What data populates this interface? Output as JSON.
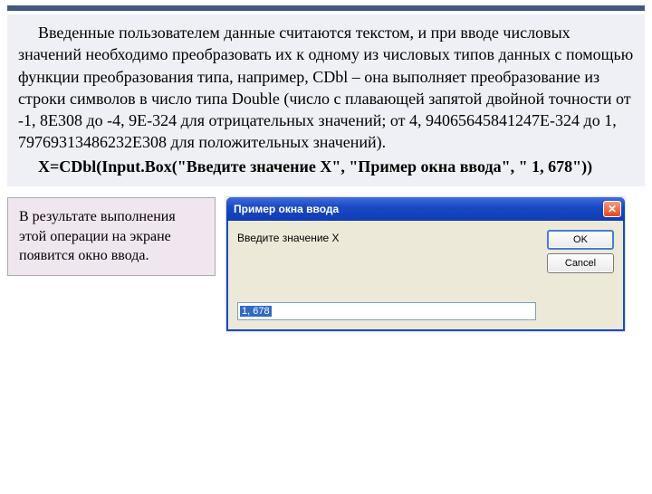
{
  "paragraph": {
    "text": "Введенные  пользователем данные считаются текстом, и при вводе числовых значений необходимо преобразовать их к одному из числовых типов данных с помощью функции преобразования типа, например, CDbl – она выполняет преобразование из строки символов в число  типа Double (число с плавающей запятой двойной точности от -1, 8E308 до -4, 9E-324 для отрицательных значений; от 4, 94065645841247E-324 до 1, 79769313486232E308 для положительных значений).",
    "code": "X=CDbl(Input.Box(\"Введите значение X\", \"Пример окна ввода\", \" 1, 678\"))"
  },
  "note": "В результате выполнения этой операции на экране появится окно ввода.",
  "dialog": {
    "title": "Пример окна ввода",
    "prompt": "Введите значение X",
    "ok": "OK",
    "cancel": "Cancel",
    "value": "1, 678"
  }
}
